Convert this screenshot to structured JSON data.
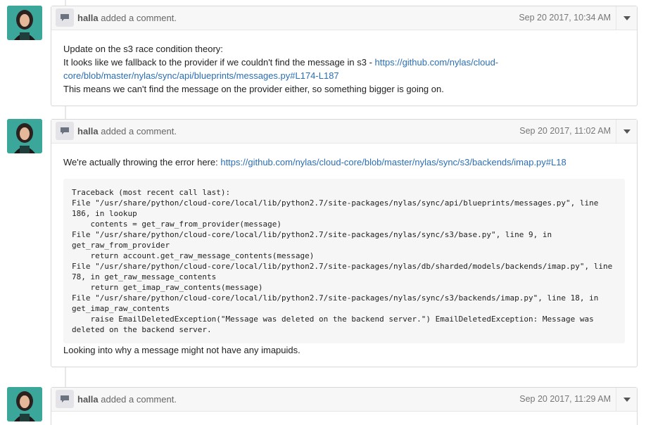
{
  "comments": [
    {
      "author": "halla",
      "action": "added a comment.",
      "timestamp": "Sep 20 2017, 10:34 AM",
      "lines": {
        "l1": "Update on the s3 race condition theory:",
        "l2_prefix": "It looks like we fallback to the provider if we couldn't find the message in s3 - ",
        "l2_link": "https://github.com/nylas/cloud-core/blob/master/nylas/sync/api/blueprints/messages.py#L174-L187",
        "l3": "This means we can't find the message on the provider either, so something bigger is going on."
      }
    },
    {
      "author": "halla",
      "action": "added a comment.",
      "timestamp": "Sep 20 2017, 11:02 AM",
      "lines": {
        "l1_prefix": "We're actually throwing the error here: ",
        "l1_link": "https://github.com/nylas/cloud-core/blob/master/nylas/sync/s3/backends/imap.py#L18",
        "code": "Traceback (most recent call last):\nFile \"/usr/share/python/cloud-core/local/lib/python2.7/site-packages/nylas/sync/api/blueprints/messages.py\", line 186, in lookup\n    contents = get_raw_from_provider(message)\nFile \"/usr/share/python/cloud-core/local/lib/python2.7/site-packages/nylas/sync/s3/base.py\", line 9, in get_raw_from_provider\n    return account.get_raw_message_contents(message)\nFile \"/usr/share/python/cloud-core/local/lib/python2.7/site-packages/nylas/db/sharded/models/backends/imap.py\", line 78, in get_raw_message_contents\n    return get_imap_raw_contents(message)\nFile \"/usr/share/python/cloud-core/local/lib/python2.7/site-packages/nylas/sync/s3/backends/imap.py\", line 18, in get_imap_raw_contents\n    raise EmailDeletedException(\"Message was deleted on the backend server.\") EmailDeletedException: Message was deleted on the backend server.",
        "l_after": "Looking into why a message might not have any imapuids."
      }
    },
    {
      "author": "halla",
      "action": "added a comment.",
      "timestamp": "Sep 20 2017, 11:29 AM"
    }
  ],
  "colors": {
    "link": "#2a6eb5",
    "avatar_bg": "#3aa79a"
  },
  "icons": {
    "comment": "speech-bubble-icon",
    "menu": "caret-down-icon"
  }
}
